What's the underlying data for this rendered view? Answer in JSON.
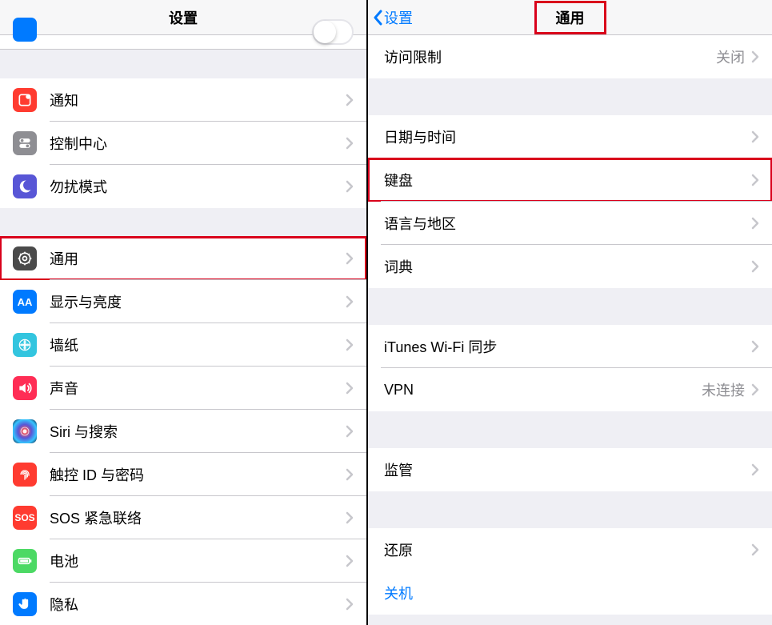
{
  "left": {
    "title": "设置",
    "groups": [
      [
        {
          "id": "notifications",
          "label": "通知",
          "icon": "notifications-icon",
          "bg": "bg-red"
        },
        {
          "id": "control-center",
          "label": "控制中心",
          "icon": "control-center-icon",
          "bg": "bg-gray"
        },
        {
          "id": "dnd",
          "label": "勿扰模式",
          "icon": "moon-icon",
          "bg": "bg-purple"
        }
      ],
      [
        {
          "id": "general",
          "label": "通用",
          "icon": "gear-icon",
          "bg": "bg-darkgray",
          "highlight": true
        },
        {
          "id": "display",
          "label": "显示与亮度",
          "icon": "display-icon",
          "bg": "bg-blue"
        },
        {
          "id": "wallpaper",
          "label": "墙纸",
          "icon": "wallpaper-icon",
          "bg": "bg-cyan"
        },
        {
          "id": "sounds",
          "label": "声音",
          "icon": "sound-icon",
          "bg": "bg-pink"
        },
        {
          "id": "siri",
          "label": "Siri 与搜索",
          "icon": "siri-icon",
          "bg": "bg-siri"
        },
        {
          "id": "touchid",
          "label": "触控 ID 与密码",
          "icon": "fingerprint-icon",
          "bg": "bg-red"
        },
        {
          "id": "sos",
          "label": "SOS 紧急联络",
          "icon": "sos-icon",
          "bg": "bg-red"
        },
        {
          "id": "battery",
          "label": "电池",
          "icon": "battery-icon",
          "bg": "bg-green"
        },
        {
          "id": "privacy",
          "label": "隐私",
          "icon": "hand-icon",
          "bg": "bg-blueh"
        }
      ]
    ]
  },
  "right": {
    "back": "设置",
    "title": "通用",
    "sections": [
      [
        {
          "id": "restrictions",
          "label": "访问限制",
          "value": "关闭"
        }
      ],
      [
        {
          "id": "datetime",
          "label": "日期与时间"
        },
        {
          "id": "keyboard",
          "label": "键盘",
          "highlight": true
        },
        {
          "id": "language",
          "label": "语言与地区"
        },
        {
          "id": "dictionary",
          "label": "词典"
        }
      ],
      [
        {
          "id": "itunes-wifi",
          "label": "iTunes Wi-Fi 同步"
        },
        {
          "id": "vpn",
          "label": "VPN",
          "value": "未连接"
        }
      ],
      [
        {
          "id": "profiles",
          "label": "监管"
        }
      ],
      [
        {
          "id": "reset",
          "label": "还原"
        }
      ],
      [
        {
          "id": "shutdown",
          "label": "关机",
          "link": true,
          "noChevron": true
        }
      ]
    ]
  }
}
